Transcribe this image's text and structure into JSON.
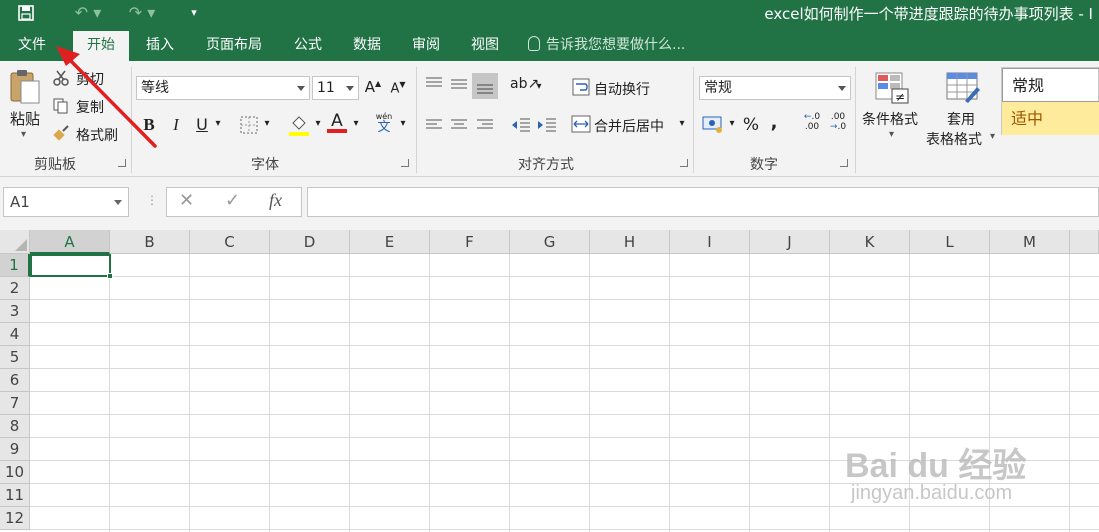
{
  "window": {
    "title": "excel如何制作一个带进度跟踪的待办事项列表 - I"
  },
  "quick_access": {
    "save_icon": "save-icon",
    "undo_icon": "undo-icon",
    "redo_icon": "redo-icon",
    "customize_icon": "customize-toolbar-icon"
  },
  "tabs": [
    {
      "label": "文件"
    },
    {
      "label": "开始"
    },
    {
      "label": "插入"
    },
    {
      "label": "页面布局"
    },
    {
      "label": "公式"
    },
    {
      "label": "数据"
    },
    {
      "label": "审阅"
    },
    {
      "label": "视图"
    }
  ],
  "active_tab": "开始",
  "tell_me": "告诉我您想要做什么...",
  "ribbon": {
    "clipboard": {
      "paste": "粘贴",
      "cut": "剪切",
      "copy": "复制",
      "format_painter": "格式刷",
      "group_label": "剪贴板"
    },
    "font": {
      "font_name": "等线",
      "font_size": "11",
      "grow": "A",
      "shrink": "A",
      "bold": "B",
      "italic": "I",
      "underline": "U",
      "phonetic_top": "wén",
      "phonetic_bottom": "文",
      "font_color_letter": "A",
      "group_label": "字体"
    },
    "alignment": {
      "wrap_text": "自动换行",
      "merge_center": "合并后居中",
      "group_label": "对齐方式"
    },
    "number": {
      "format": "常规",
      "percent": "%",
      "comma": ",",
      "group_label": "数字"
    },
    "styles": {
      "conditional_formatting": "条件格式",
      "format_as_table_line1": "套用",
      "format_as_table_line2": "表格格式",
      "style_normal": "常规",
      "style_neutral": "适中"
    }
  },
  "formula_bar": {
    "name_box": "A1",
    "cancel": "✕",
    "enter": "✓",
    "fx": "fx",
    "formula": ""
  },
  "sheet": {
    "columns": [
      "A",
      "B",
      "C",
      "D",
      "E",
      "F",
      "G",
      "H",
      "I",
      "J",
      "K",
      "L",
      "M"
    ],
    "rows": [
      "1",
      "2",
      "3",
      "4",
      "5",
      "6",
      "7",
      "8",
      "9",
      "10",
      "11",
      "12"
    ],
    "selected_cell": "A1"
  },
  "watermark": {
    "brand": "Bai du 经验",
    "url": "jingyan.baidu.com"
  },
  "colors": {
    "excel_green": "#217346",
    "annotation_red": "#e02020"
  }
}
